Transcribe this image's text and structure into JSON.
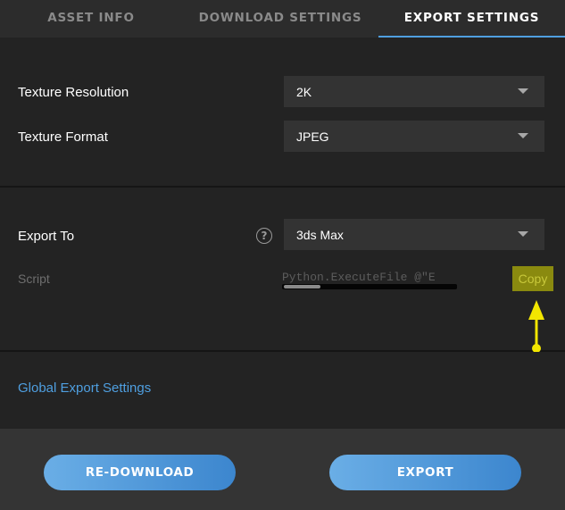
{
  "tabs": [
    {
      "label": "ASSET INFO",
      "active": false
    },
    {
      "label": "DOWNLOAD SETTINGS",
      "active": false
    },
    {
      "label": "EXPORT SETTINGS",
      "active": true
    }
  ],
  "texture": {
    "resolution_label": "Texture Resolution",
    "resolution_value": "2K",
    "format_label": "Texture Format",
    "format_value": "JPEG"
  },
  "export": {
    "to_label": "Export To",
    "help_glyph": "?",
    "to_value": "3ds Max",
    "script_label": "Script",
    "script_value": "Python.ExecuteFile @\"E",
    "copy_label": "Copy",
    "script_scroll_position": 0.0
  },
  "global": {
    "link_label": "Global Export Settings"
  },
  "footer": {
    "redownload_label": "RE-DOWNLOAD",
    "export_label": "EXPORT"
  },
  "colors": {
    "accent": "#4f9fe0",
    "annotation_arrow": "#f2e600",
    "copy_button_bg": "#8a8a0f"
  },
  "icons": {
    "dropdown": "caret-down-icon",
    "help": "help-circle-icon",
    "annotation": "arrow-up-icon"
  }
}
